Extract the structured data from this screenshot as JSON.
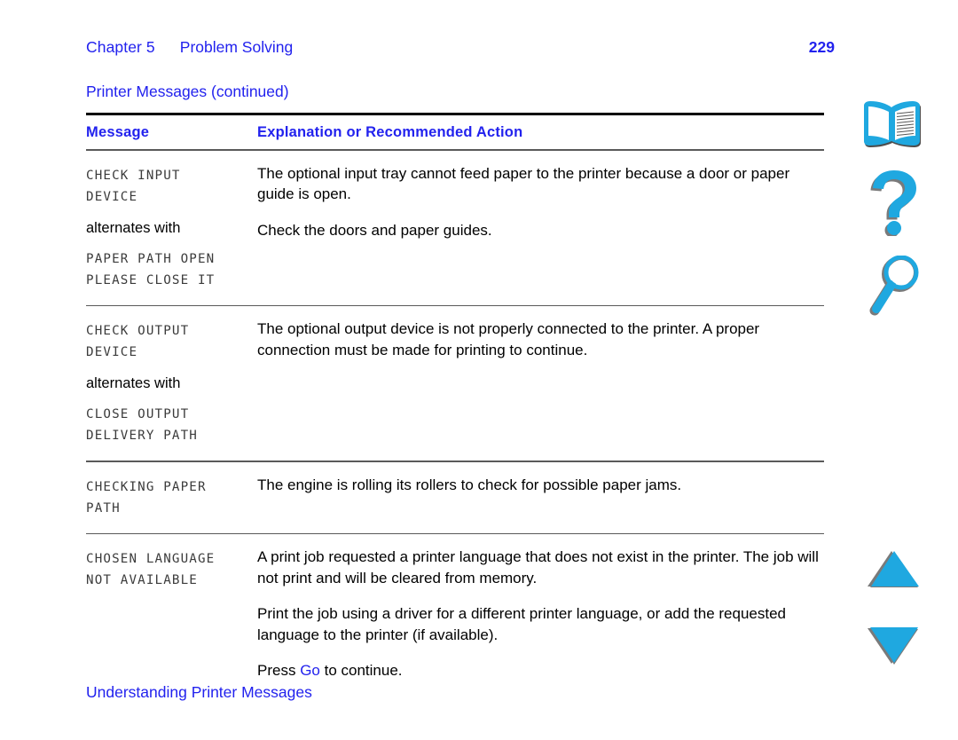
{
  "header": {
    "chapter_label": "Chapter 5",
    "chapter_title": "Problem Solving",
    "page_number": "229"
  },
  "table_caption": "Printer Messages (continued)",
  "table": {
    "columns": {
      "message": "Message",
      "explanation": "Explanation or Recommended Action"
    },
    "rows": [
      {
        "message_lines": [
          "CHECK INPUT",
          "DEVICE"
        ],
        "alternates_label": "alternates with",
        "message_lines_alt": [
          "PAPER PATH OPEN",
          "PLEASE CLOSE IT"
        ],
        "paragraphs": [
          "The optional input tray cannot feed paper to the printer because a door or paper guide is open.",
          "Check the doors and paper guides."
        ]
      },
      {
        "message_lines": [
          "CHECK OUTPUT",
          "DEVICE"
        ],
        "alternates_label": "alternates with",
        "message_lines_alt": [
          "CLOSE OUTPUT",
          "DELIVERY PATH"
        ],
        "paragraphs": [
          "The optional output device is not properly connected to the printer. A proper connection must be made for printing to continue."
        ]
      },
      {
        "message_lines": [
          "CHECKING PAPER",
          "PATH"
        ],
        "alternates_label": "",
        "message_lines_alt": [],
        "paragraphs": [
          "The engine is rolling its rollers to check for possible paper jams."
        ]
      },
      {
        "message_lines": [
          "CHOSEN LANGUAGE",
          "NOT AVAILABLE"
        ],
        "alternates_label": "",
        "message_lines_alt": [],
        "paragraphs": [
          "A print job requested a printer language that does not exist in the printer. The job will not print and will be cleared from memory.",
          "Print the job using a driver for a different printer language, or add the requested language to the printer (if available)."
        ],
        "final_line": {
          "before": "Press ",
          "keyword": "Go",
          "after": " to continue."
        }
      }
    ]
  },
  "footer": {
    "link": "Understanding Printer Messages"
  },
  "nav_rail": {
    "book_icon": "book-icon",
    "help_icon": "question-mark-icon",
    "find_icon": "magnifier-icon",
    "prev_icon": "triangle-up-icon",
    "next_icon": "triangle-down-icon"
  },
  "colors": {
    "link_blue": "#2222ee",
    "icon_cyan": "#1fa8e0",
    "icon_shadow": "#7a7a7a",
    "lcd_gray": "#3b3b3b",
    "rule_black": "#000000",
    "rule_gray": "#5a5a5a"
  }
}
